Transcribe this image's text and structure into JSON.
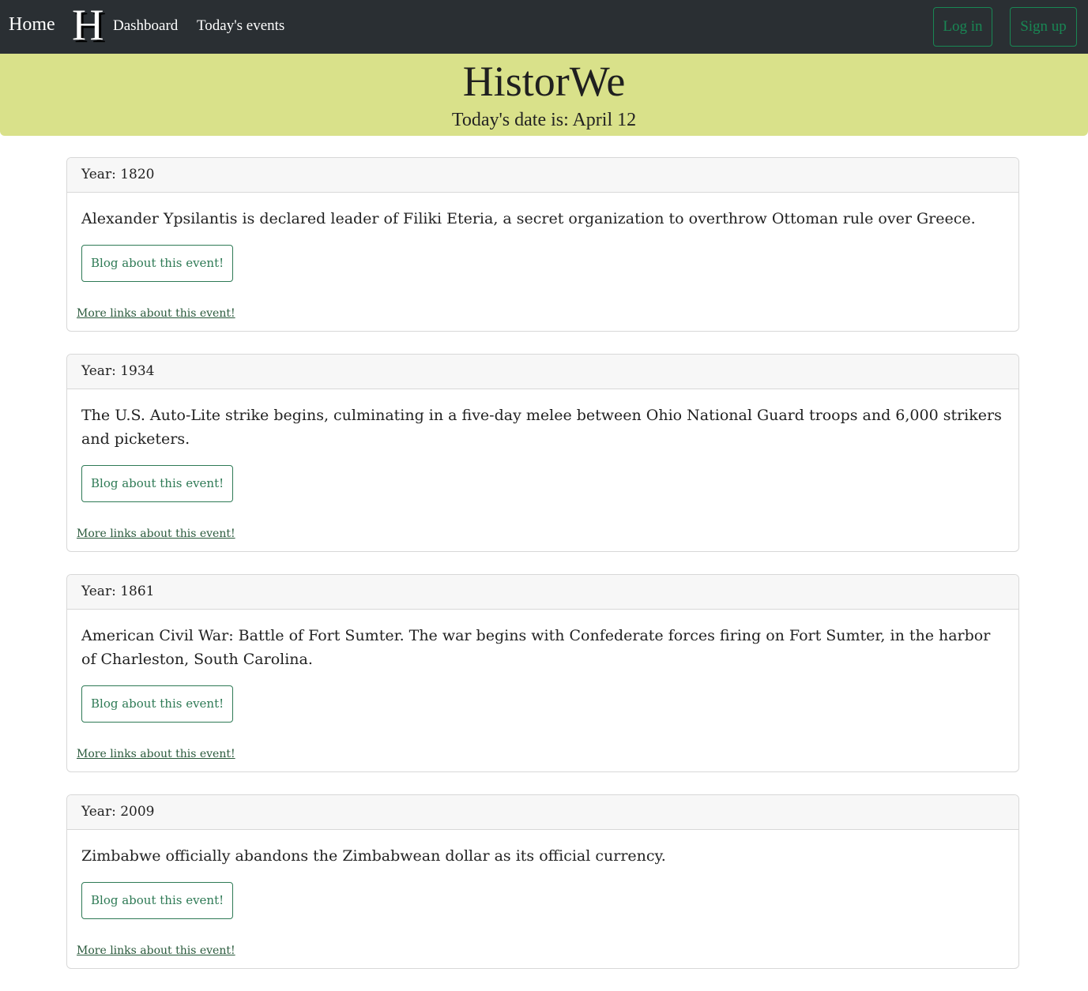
{
  "nav": {
    "home": "Home",
    "logo": "H",
    "dashboard": "Dashboard",
    "today_events": "Today's events",
    "login": "Log in",
    "signup": "Sign up"
  },
  "banner": {
    "title": "HistorWe",
    "date_text": "Today's date is: April 12"
  },
  "colors": {
    "navbar_bg": "#2a2f33",
    "banner_bg": "#d9e18a",
    "accent_green": "#198754"
  },
  "events": [
    {
      "year": "Year: 1820",
      "text": "Alexander Ypsilantis is declared leader of Filiki Eteria, a secret organization to overthrow Ottoman rule over Greece.",
      "blog_label": "Blog about this event!",
      "more_links": "More links about this event!"
    },
    {
      "year": "Year: 1934",
      "text": "The U.S. Auto-Lite strike begins, culminating in a five-day melee between Ohio National Guard troops and 6,000 strikers and picketers.",
      "blog_label": "Blog about this event!",
      "more_links": "More links about this event!"
    },
    {
      "year": "Year: 1861",
      "text": "American Civil War: Battle of Fort Sumter. The war begins with Confederate forces firing on Fort Sumter, in the harbor of Charleston, South Carolina.",
      "blog_label": "Blog about this event!",
      "more_links": "More links about this event!"
    },
    {
      "year": "Year: 2009",
      "text": "Zimbabwe officially abandons the Zimbabwean dollar as its official currency.",
      "blog_label": "Blog about this event!",
      "more_links": "More links about this event!"
    }
  ]
}
